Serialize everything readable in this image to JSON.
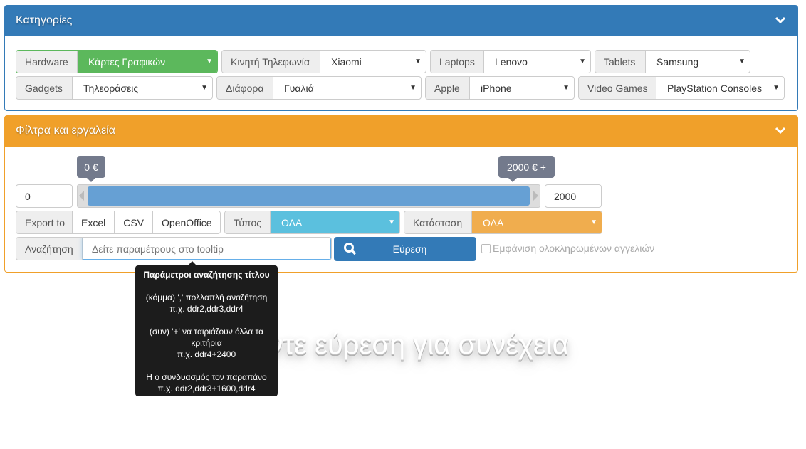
{
  "categories": {
    "title": "Κατηγορίες",
    "rows": [
      [
        {
          "label": "Hardware",
          "value": "Κάρτες Γραφικών"
        },
        {
          "label": "Κινητή Τηλεφωνία",
          "value": "Xiaomi"
        },
        {
          "label": "Laptops",
          "value": "Lenovo"
        },
        {
          "label": "Tablets",
          "value": "Samsung"
        }
      ],
      [
        {
          "label": "Gadgets",
          "value": "Τηλεοράσεις"
        },
        {
          "label": "Διάφορα",
          "value": "Γυαλιά"
        },
        {
          "label": "Apple",
          "value": "iPhone"
        },
        {
          "label": "Video Games",
          "value": "PlayStation Consoles"
        }
      ]
    ]
  },
  "filters": {
    "title": "Φίλτρα και εργαλεία",
    "price": {
      "min_label": "0 €",
      "max_label": "2000 € +",
      "min_value": "0",
      "max_value": "2000",
      "range_fraction": [
        0,
        1
      ]
    },
    "export": {
      "label": "Export to",
      "buttons": [
        "Excel",
        "CSV",
        "OpenOffice"
      ]
    },
    "type": {
      "label": "Τύπος",
      "value": "ΟΛΑ"
    },
    "status": {
      "label": "Κατάσταση",
      "value": "ΟΛΑ"
    },
    "search": {
      "label": "Αναζήτηση",
      "placeholder": "Δείτε παραμέτρους στο tooltip",
      "button": "Εύρεση",
      "checkbox_label": "Εμφάνιση ολοκληρωμένων αγγελιών",
      "checked": false
    },
    "tooltip": {
      "title": "Παράμετροι αναζήτησης τίτλου",
      "lines": [
        "(κόμμα) ',' πολλαπλή αναζήτηση",
        "π.χ. ddr2,ddr3,ddr4",
        "",
        "(συν) '+' να ταιριάζουν όλλα τα κριτήρια",
        "π.χ. ddr4+2400",
        "",
        "Η ο συνδυασμός τον παραπάνο",
        "π.χ. ddr2,ddr3+1600,ddr4"
      ]
    }
  },
  "message": "Κάντε εύρεση για συνέχεια",
  "colors": {
    "primary": "#337ab7",
    "warning": "#f0a02a",
    "success": "#5cb85c",
    "info": "#5bc0de",
    "orange": "#f0ad4e"
  }
}
